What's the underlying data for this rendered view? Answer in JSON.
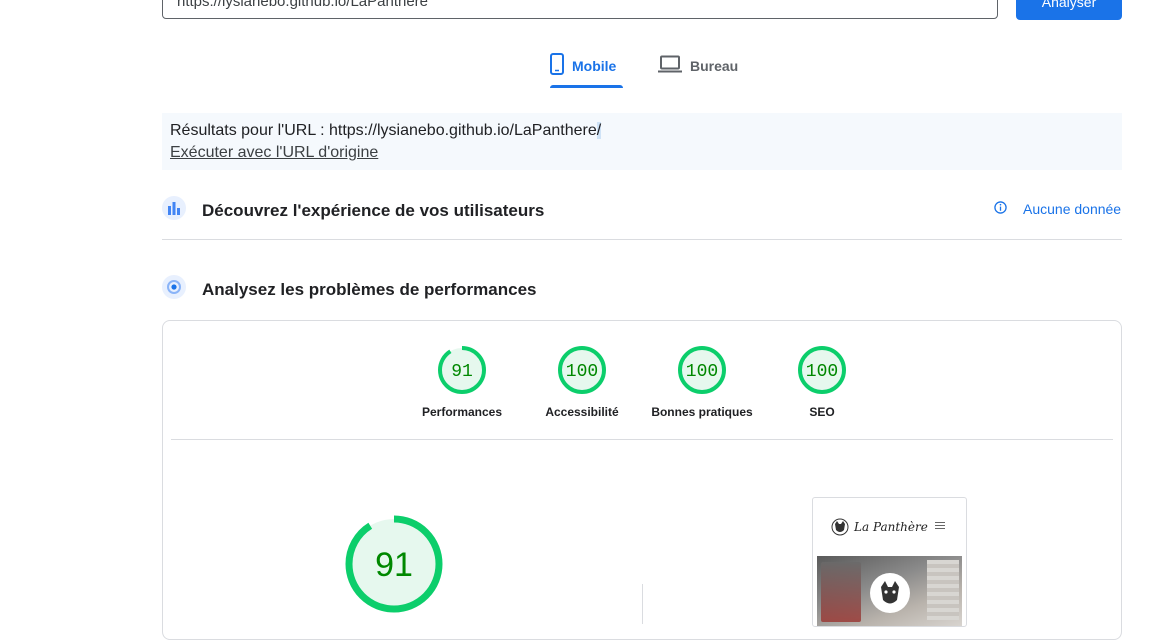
{
  "search": {
    "value": "https://lysianebo.github.io/LaPanthere",
    "button_label": "Analyser"
  },
  "tabs": [
    {
      "label": "Mobile",
      "icon": "smartphone-icon",
      "active": true
    },
    {
      "label": "Bureau",
      "icon": "laptop-icon",
      "active": false
    }
  ],
  "results": {
    "prefix": "Résultats pour l'URL : ",
    "url": "https://lysianebo.github.io/LaPanthere",
    "url_tail": "/",
    "origin_link": "Exécuter avec l'URL d'origine"
  },
  "sections": {
    "experience": {
      "title": "Découvrez l'expérience de vos utilisateurs",
      "status": "Aucune donnée",
      "status_icon": "info-icon"
    },
    "performance": {
      "title": "Analysez les problèmes de performances"
    }
  },
  "scores": [
    {
      "value": "91",
      "label": "Performances"
    },
    {
      "value": "100",
      "label": "Accessibilité"
    },
    {
      "value": "100",
      "label": "Bonnes pratiques"
    },
    {
      "value": "100",
      "label": "SEO"
    }
  ],
  "main_score": "91",
  "preview": {
    "brand": "La Panthère"
  },
  "colors": {
    "accent": "#1a73e8",
    "pass": "#0cce6b",
    "pass_text": "#008800",
    "pass_fill": "#e6f8ee"
  }
}
